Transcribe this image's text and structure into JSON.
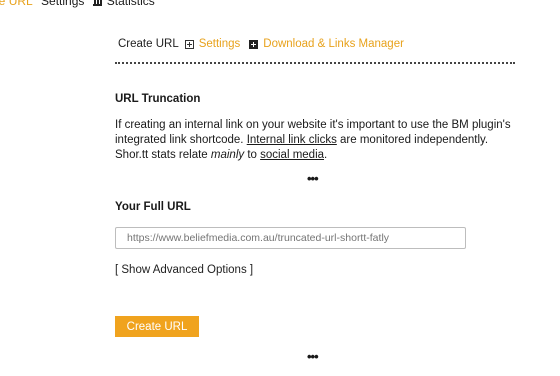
{
  "topnav": {
    "items": [
      {
        "label": "eate URL"
      },
      {
        "label": "Settings"
      },
      {
        "label": "Statistics"
      }
    ]
  },
  "tabs": {
    "create": "Create URL",
    "settings": "Settings",
    "download": "Download & Links Manager"
  },
  "truncation": {
    "heading": "URL Truncation",
    "text1": "If creating an internal link on your website it's important to use the BM plugin's integrated link shortcode. ",
    "link1": "Internal link clicks",
    "text2": " are monitored independently. Shor.tt stats relate ",
    "em": "mainly",
    "text3": " to ",
    "link2": "social media",
    "text4": "."
  },
  "dots": "•••",
  "form": {
    "heading": "Your Full URL",
    "placeholder": "https://www.beliefmedia.com.au/truncated-url-shortt-fatly",
    "advanced": "[ Show Advanced Options ]",
    "submit": "Create URL"
  },
  "colors": {
    "accent": "#e8a21c",
    "button": "#f0a31e"
  }
}
